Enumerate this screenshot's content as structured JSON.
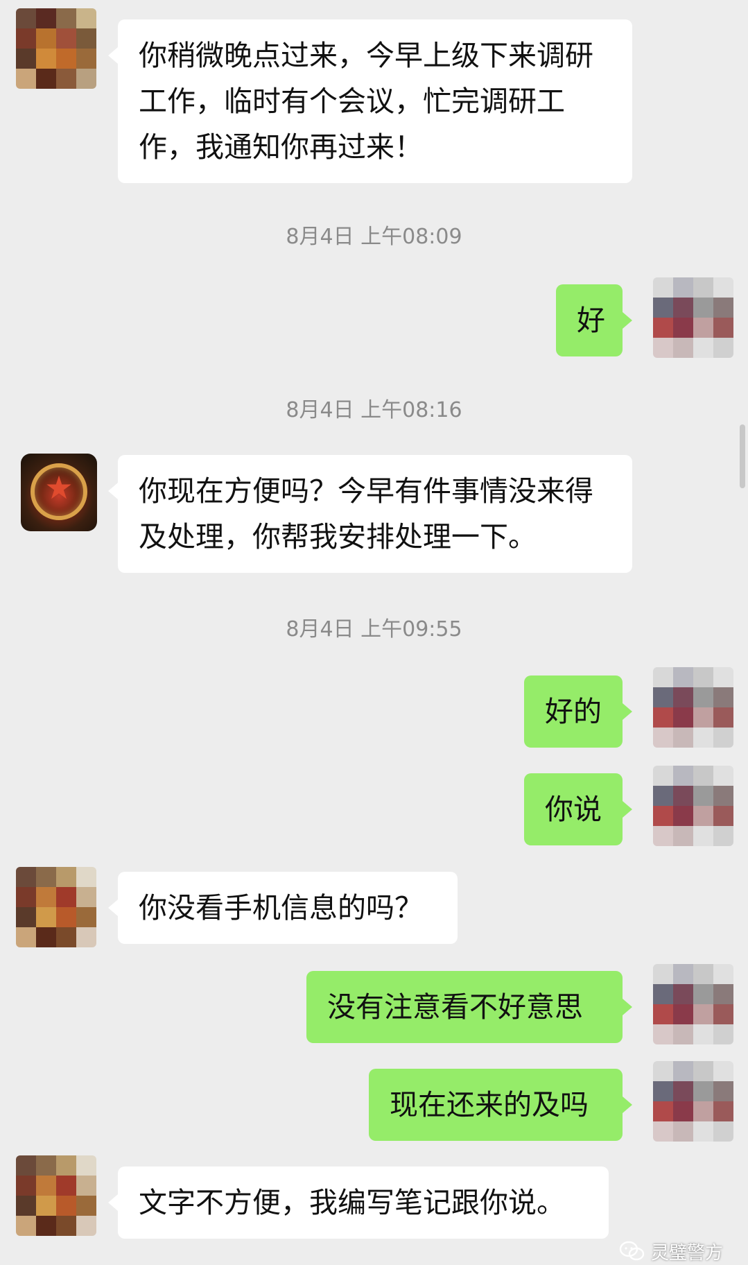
{
  "messages": [
    {
      "side": "in",
      "text": "你稍微晚点过来，今早上级下来调研工作，临时有个会议，忙完调研工作，我通知你再过来！"
    },
    {
      "side": "out",
      "text": "好"
    },
    {
      "side": "in",
      "text": "你现在方便吗？今早有件事情没来得及处理，你帮我安排处理一下。"
    },
    {
      "side": "out",
      "text": "好的"
    },
    {
      "side": "out",
      "text": "你说"
    },
    {
      "side": "in",
      "text": "你没看手机信息的吗？"
    },
    {
      "side": "out",
      "text": "没有注意看不好意思"
    },
    {
      "side": "out",
      "text": "现在还来的及吗"
    },
    {
      "side": "in",
      "text": "文字不方便，我编写笔记跟你说。"
    }
  ],
  "timestamps": [
    "8月4日 上午08:09",
    "8月4日 上午08:16",
    "8月4日 上午09:55"
  ],
  "watermark": {
    "text": "灵璧警方",
    "icon": "wechat-official-account-icon"
  },
  "colors": {
    "background": "#ededed",
    "incoming_bubble": "#ffffff",
    "outgoing_bubble": "#95ec69",
    "timestamp_text": "#8a8a8a"
  },
  "avatars": {
    "contact_emblem_icon": "police-emblem-icon",
    "pixelated": true
  }
}
